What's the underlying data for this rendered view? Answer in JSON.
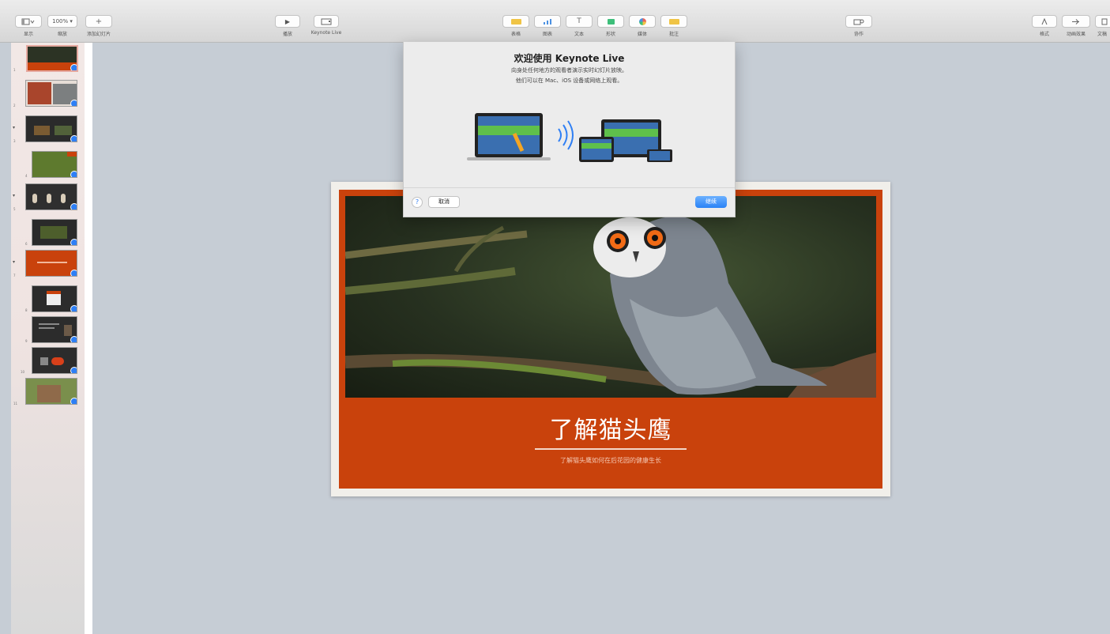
{
  "toolbar": {
    "view": {
      "label": "显示"
    },
    "zoom": {
      "label": "缩放",
      "value": "100% ▾"
    },
    "add_slide": {
      "label": "添加幻灯片",
      "icon": "plus-icon"
    },
    "play": {
      "label": "播放",
      "icon": "play-icon"
    },
    "keynote_live": {
      "label": "Keynote Live",
      "icon": "live-screen-icon"
    },
    "table": {
      "label": "表格",
      "icon": "table-icon",
      "color": "#f0c445"
    },
    "chart": {
      "label": "图表",
      "icon": "chart-icon",
      "color": "#4a90e2"
    },
    "text": {
      "label": "文本",
      "icon": "text-icon",
      "value": "T"
    },
    "shape": {
      "label": "形状",
      "icon": "shape-icon",
      "color": "#3dbf7a"
    },
    "media": {
      "label": "媒体",
      "icon": "media-icon",
      "color": "#e8655a"
    },
    "comment": {
      "label": "批注",
      "icon": "comment-icon",
      "color": "#f0c445"
    },
    "collaborate": {
      "label": "协作",
      "icon": "collaborate-icon"
    },
    "format": {
      "label": "格式",
      "icon": "format-brush-icon"
    },
    "animate": {
      "label": "动画效果",
      "icon": "animate-icon"
    },
    "document": {
      "label": "文稿",
      "icon": "document-icon"
    }
  },
  "sidebar": {
    "slides": [
      {
        "num": "1",
        "selected": true
      },
      {
        "num": "2"
      },
      {
        "num": "3",
        "collapse": "▾"
      },
      {
        "num": "4"
      },
      {
        "num": "5",
        "collapse": "▾"
      },
      {
        "num": "6"
      },
      {
        "num": "7",
        "collapse": "▾"
      },
      {
        "num": "8"
      },
      {
        "num": "9"
      },
      {
        "num": "10"
      },
      {
        "num": "11"
      }
    ]
  },
  "popover": {
    "title": "欢迎使用 Keynote Live",
    "desc_line1": "向身处任何地方的观看者演示实时幻灯片放映。",
    "desc_line2": "他们可以在 Mac、iOS 设备或网络上观看。",
    "help": "?",
    "cancel": "取消",
    "continue": "继续"
  },
  "slide": {
    "title": "了解猫头鹰",
    "subtitle": "了解猫头鹰如何在后花园的健康生长"
  },
  "colors": {
    "accent_orange": "#c9420c",
    "canvas_bg": "#c6cdd5",
    "primary_blue": "#2a82f6"
  }
}
